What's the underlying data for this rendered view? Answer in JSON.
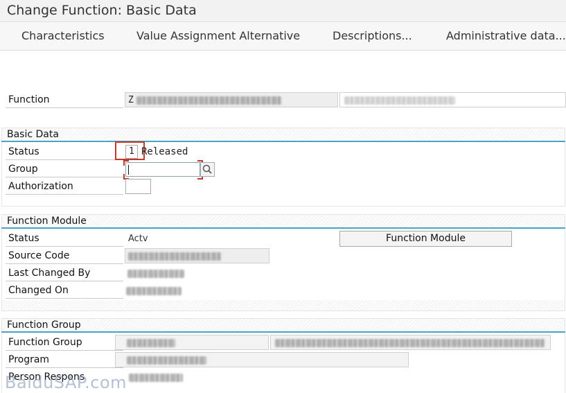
{
  "window": {
    "title": "Change Function: Basic Data"
  },
  "toolbar": {
    "characteristics": "Characteristics",
    "value_assignment": "Value Assignment Alternative",
    "descriptions": "Descriptions...",
    "administrative": "Administrative data..."
  },
  "function_row": {
    "label": "Function",
    "value_prefix": "Z"
  },
  "basic_data": {
    "title": "Basic Data",
    "status_label": "Status",
    "status_value": "1",
    "status_text": "Released",
    "group_label": "Group",
    "authorization_label": "Authorization"
  },
  "function_module": {
    "title": "Function Module",
    "status_label": "Status",
    "status_value": "Actv",
    "source_code_label": "Source Code",
    "last_changed_by_label": "Last Changed By",
    "changed_on_label": "Changed On",
    "button_label": "Function Module"
  },
  "function_group": {
    "title": "Function Group",
    "function_group_label": "Function Group",
    "program_label": "Program",
    "person_responsible_label": "Person Respons"
  },
  "watermark": "BaiduSAP.com",
  "colors": {
    "section_line": "#4ba3c3",
    "focus_red": "#c0392b"
  },
  "icons": {
    "search": "search-icon"
  }
}
